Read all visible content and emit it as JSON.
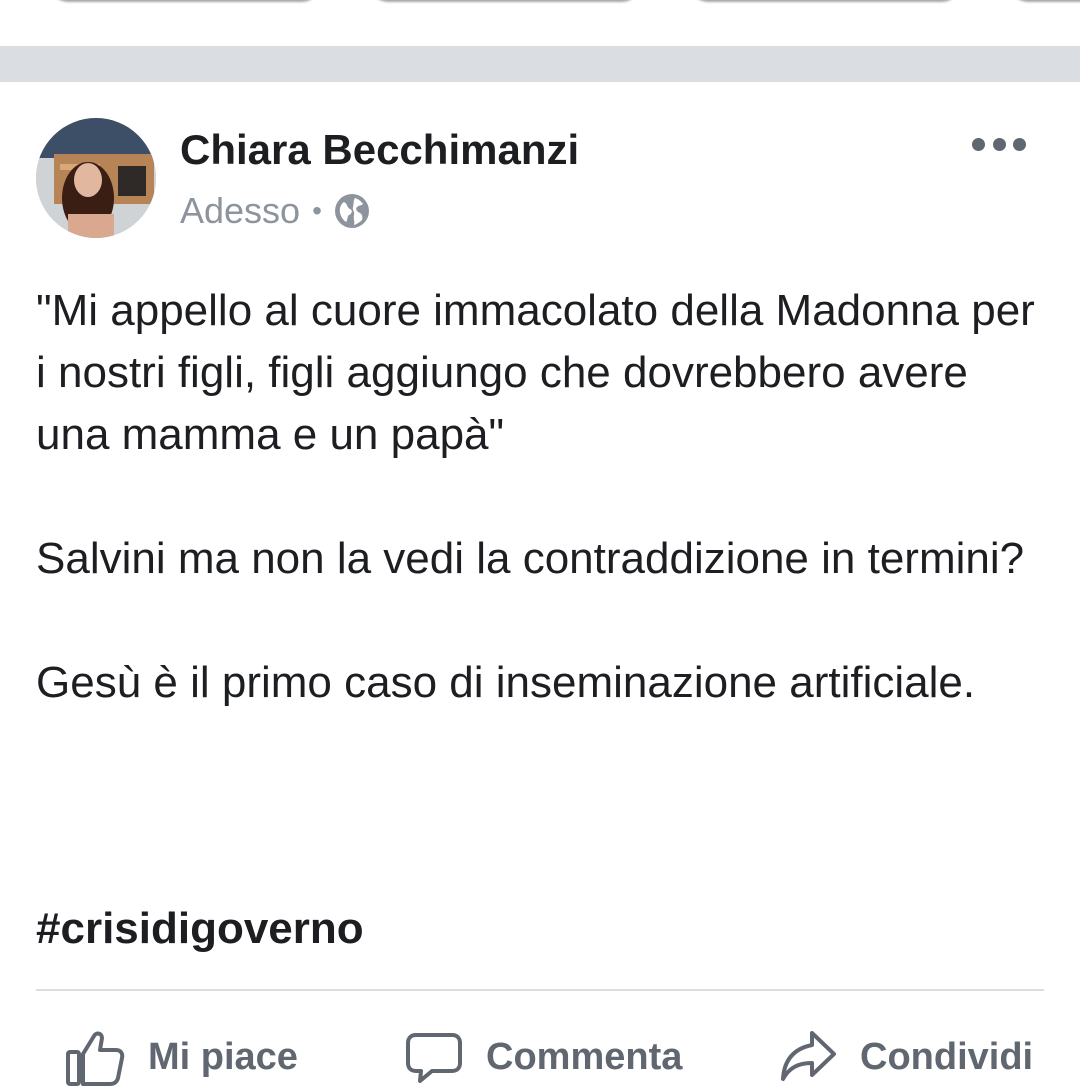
{
  "post": {
    "author": "Chiara Becchimanzi",
    "timestamp": "Adesso",
    "separator": "•",
    "privacy_icon": "globe-icon",
    "paragraphs": [
      "\"Mi appello al cuore immacolato della Madonna per i nostri figli, figli aggiungo che dovrebbero avere una mamma e un papà\"",
      "Salvini ma non la vedi la contraddizione in termini?",
      "Gesù è il primo caso di inseminazione artificiale."
    ],
    "hashtag": "#crisidigoverno"
  },
  "actions": {
    "like": "Mi piace",
    "comment": "Commenta",
    "share": "Condividi"
  },
  "colors": {
    "text": "#1c1e21",
    "secondary": "#606770",
    "meta": "#8d949e",
    "separator": "#dadde1"
  }
}
